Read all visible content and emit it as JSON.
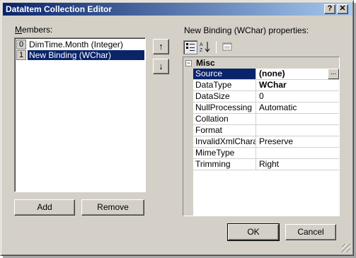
{
  "window": {
    "title": "DataItem Collection Editor",
    "help_glyph": "?",
    "close_glyph": "✕"
  },
  "members": {
    "label": "Members:",
    "items": [
      {
        "index": "0",
        "text": "DimTime.Month (Integer)"
      },
      {
        "index": "1",
        "text": "New Binding (WChar)"
      }
    ],
    "add_label": "Add",
    "remove_label": "Remove"
  },
  "properties": {
    "label": "New Binding (WChar) properties:",
    "category": "Misc",
    "category_toggle": "−",
    "rows": [
      {
        "name": "Source",
        "value": "(none)",
        "value_bold": true,
        "ellipsis": "..."
      },
      {
        "name": "DataType",
        "value": "WChar",
        "value_bold": true
      },
      {
        "name": "DataSize",
        "value": "0"
      },
      {
        "name": "NullProcessing",
        "value": "Automatic"
      },
      {
        "name": "Collation",
        "value": ""
      },
      {
        "name": "Format",
        "value": ""
      },
      {
        "name": "InvalidXmlCharacters",
        "value": "Preserve"
      },
      {
        "name": "MimeType",
        "value": ""
      },
      {
        "name": "Trimming",
        "value": "Right"
      }
    ]
  },
  "buttons": {
    "ok": "OK",
    "cancel": "Cancel"
  },
  "icons": {
    "up_arrow": "↑",
    "down_arrow": "↓",
    "categorized": "categorized-icon",
    "alphabetical": "alphabetical-icon",
    "property_pages": "property-pages-icon"
  }
}
